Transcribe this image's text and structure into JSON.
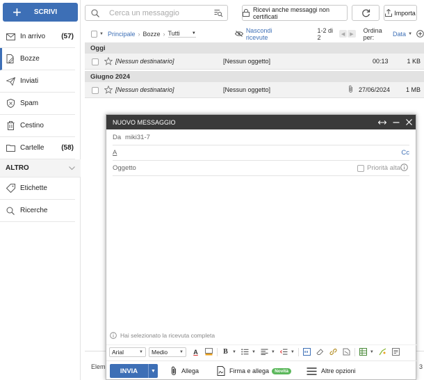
{
  "compose_button": {
    "label": "SCRIVI"
  },
  "sidebar": {
    "items": [
      {
        "label": "In arrivo",
        "count": "(57)"
      },
      {
        "label": "Bozze",
        "count": ""
      },
      {
        "label": "Inviati",
        "count": ""
      },
      {
        "label": "Spam",
        "count": ""
      },
      {
        "label": "Cestino",
        "count": ""
      },
      {
        "label": "Cartelle",
        "count": "(58)"
      }
    ],
    "section": "ALTRO",
    "extra_items": [
      {
        "label": "Etichette"
      },
      {
        "label": "Ricerche"
      }
    ]
  },
  "search": {
    "placeholder": "Cerca un messaggio"
  },
  "toolbar": {
    "uncertified_label": "Ricevi anche messaggi non certificati",
    "import_label": "Importa"
  },
  "list_toolbar": {
    "breadcrumb": [
      "Principale",
      "Bozze"
    ],
    "filter_value": "Tutti",
    "hide_receipts": "Nascondi ricevute",
    "page_range": "1-2 di 2",
    "sort_label": "Ordina per:",
    "sort_value": "Data"
  },
  "groups": [
    {
      "label": "Oggi",
      "rows": [
        {
          "recipient": "[Nessun destinatario]",
          "subject": "[Nessun oggetto]",
          "date": "00:13",
          "size": "1 KB",
          "attachment": false
        }
      ]
    },
    {
      "label": "Giugno 2024",
      "rows": [
        {
          "recipient": "[Nessun destinatario]",
          "subject": "[Nessun oggetto]",
          "date": "27/06/2024",
          "size": "1 MB",
          "attachment": true
        }
      ]
    }
  ],
  "bg_footer_text": "Elem",
  "bg_footer_right": "3",
  "compose": {
    "title": "NUOVO MESSAGGIO",
    "from_label": "Da",
    "from_value": "miki31-7",
    "to_label": "A",
    "cc_label": "Cc",
    "subject_placeholder": "Oggetto",
    "priority_label": "Priorità alta",
    "receipt_notice": "Hai selezionato la ricevuta completa",
    "font_value": "Arial",
    "size_value": "Medio",
    "send_label": "INVIA",
    "attach_label": "Allega",
    "sign_attach_label": "Firma e allega",
    "new_badge": "Novità",
    "more_options_label": "Altre opzioni"
  },
  "colors": {
    "accent": "#3d6fb6",
    "header_dark": "#3a3a3a",
    "badge_green": "#5cb85c"
  }
}
